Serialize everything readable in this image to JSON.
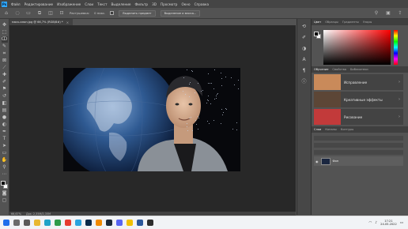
{
  "menubar": {
    "items": [
      "Файл",
      "Редактирование",
      "Изображение",
      "Слои",
      "Текст",
      "Выделение",
      "Фильтр",
      "3D",
      "Просмотр",
      "Окно",
      "Справка"
    ]
  },
  "options": {
    "feather_label": "Растушевка:",
    "feather_value": "0 пикс.",
    "select_subject": "Выделить предмет",
    "select_and_mask": "Выделение и маска..."
  },
  "document": {
    "tab_title": "маск-илон.jpg @ 66,7% (RGB/8#) *"
  },
  "status": {
    "zoom": "66,67%",
    "doc_size": "Док: 2,35M/2,35M"
  },
  "panels": {
    "color_tabs": [
      "Цвет",
      "Образцы",
      "Градиенты",
      "Узоры"
    ],
    "learn_tabs": [
      "Обучение",
      "Свойства",
      "Библиотеки"
    ],
    "learn_cards": [
      {
        "label": "Исправление",
        "thumb_color": "#c98a5a"
      },
      {
        "label": "Креативные эффекты",
        "thumb_color": "#5c4636"
      },
      {
        "label": "Рисование",
        "thumb_color": "#c23a3a"
      }
    ],
    "layer_tabs": [
      "Слои",
      "Каналы",
      "Контуры"
    ],
    "layer_name": "Фон"
  },
  "taskbar": {
    "time": "17:21",
    "date": "24.05.2022",
    "apps": [
      {
        "icon": "start-icon",
        "color": "#1f6feb"
      },
      {
        "icon": "search-icon",
        "color": "#6b6b6b"
      },
      {
        "icon": "task-view-icon",
        "color": "#5a5a5a"
      },
      {
        "icon": "file-explorer-icon",
        "color": "#e8b730"
      },
      {
        "icon": "edge-icon",
        "color": "#1fa3c8"
      },
      {
        "icon": "chrome-icon",
        "color": "#2e9b4a"
      },
      {
        "icon": "yandex-icon",
        "color": "#e63b2e"
      },
      {
        "icon": "telegram-icon",
        "color": "#2aa3de"
      },
      {
        "icon": "photoshop-icon",
        "color": "#0a2a4a"
      },
      {
        "icon": "vlc-icon",
        "color": "#f08a00"
      },
      {
        "icon": "steam-icon",
        "color": "#1b2838"
      },
      {
        "icon": "discord-icon",
        "color": "#5865f2"
      },
      {
        "icon": "explorer-icon",
        "color": "#f0c000"
      },
      {
        "icon": "word-icon",
        "color": "#2b579a"
      },
      {
        "icon": "obs-icon",
        "color": "#2d2d2d"
      }
    ]
  }
}
